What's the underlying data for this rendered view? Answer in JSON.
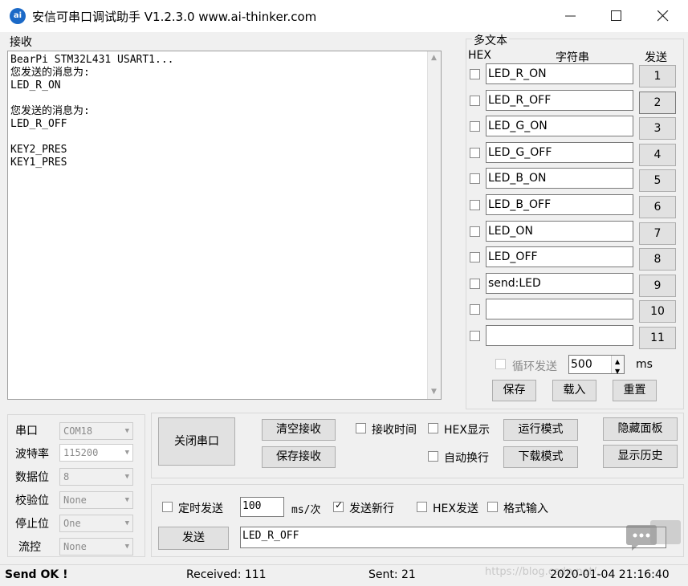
{
  "window": {
    "title": "安信可串口调试助手 V1.2.3.0    www.ai-thinker.com",
    "icon_label": "ai",
    "minimize_icon": "minimize-icon",
    "maximize_icon": "maximize-icon",
    "close_icon": "close-icon"
  },
  "receive": {
    "label": "接收",
    "text": "BearPi STM32L431 USART1...\n您发送的消息为:\nLED_R_ON\n\n您发送的消息为:\nLED_R_OFF\n\nKEY2_PRES\nKEY1_PRES"
  },
  "multi": {
    "title": "多文本",
    "hex_header": "HEX",
    "string_header": "字符串",
    "send_header": "发送",
    "rows": [
      {
        "hex": false,
        "text": "LED_R_ON",
        "btn": "1"
      },
      {
        "hex": false,
        "text": "LED_R_OFF",
        "btn": "2"
      },
      {
        "hex": false,
        "text": "LED_G_ON",
        "btn": "3"
      },
      {
        "hex": false,
        "text": "LED_G_OFF",
        "btn": "4"
      },
      {
        "hex": false,
        "text": "LED_B_ON",
        "btn": "5"
      },
      {
        "hex": false,
        "text": "LED_B_OFF",
        "btn": "6"
      },
      {
        "hex": false,
        "text": "LED_ON",
        "btn": "7"
      },
      {
        "hex": false,
        "text": "LED_OFF",
        "btn": "8"
      },
      {
        "hex": false,
        "text": "send:LED",
        "btn": "9"
      },
      {
        "hex": false,
        "text": "",
        "btn": "10"
      },
      {
        "hex": false,
        "text": "",
        "btn": "11"
      }
    ],
    "loop_send_label": "循环发送",
    "loop_interval": "500",
    "loop_unit": "ms",
    "save_label": "保存",
    "load_label": "载入",
    "reset_label": "重置"
  },
  "serial": {
    "port_label": "串口",
    "port_value": "COM18",
    "baud_label": "波特率",
    "baud_value": "115200",
    "databits_label": "数据位",
    "databits_value": "8",
    "parity_label": "校验位",
    "parity_value": "None",
    "stopbits_label": "停止位",
    "stopbits_value": "One",
    "flow_label": "流控",
    "flow_value": "None"
  },
  "controls": {
    "close_port_label": "关闭串口",
    "clear_recv_label": "清空接收",
    "save_recv_label": "保存接收",
    "recv_time_label": "接收时间",
    "hex_display_label": "HEX显示",
    "auto_wrap_label": "自动换行",
    "run_mode_label": "运行模式",
    "download_mode_label": "下载模式",
    "hide_panel_label": "隐藏面板",
    "show_history_label": "显示历史"
  },
  "send": {
    "timed_send_label": "定时发送",
    "timed_interval": "100",
    "timed_unit": "ms/次",
    "send_newline_label": "发送新行",
    "send_newline_checked": true,
    "hex_send_label": "HEX发送",
    "format_input_label": "格式输入",
    "send_button_label": "发送",
    "send_text": "LED_R_OFF"
  },
  "status": {
    "message": "Send OK !",
    "received": "Received: 111",
    "sent": "Sent: 21",
    "datetime": "2020-01-04 21:16:40",
    "watermark": "https://blog.csdn.net/..."
  }
}
